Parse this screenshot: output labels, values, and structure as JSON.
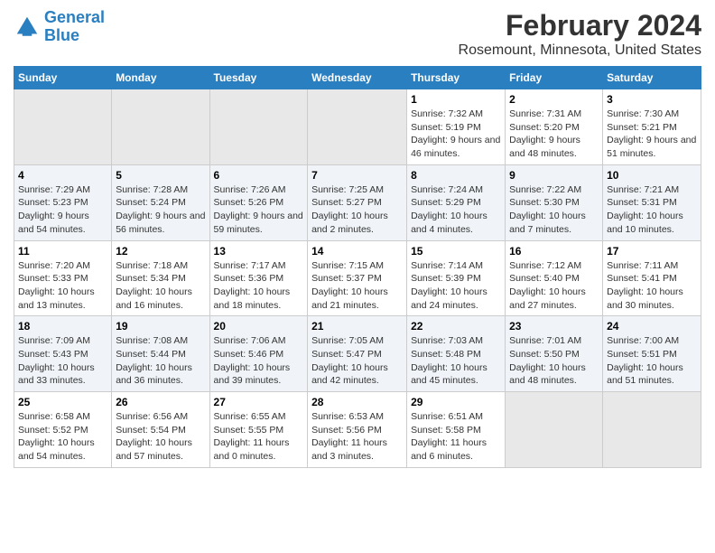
{
  "header": {
    "logo_line1": "General",
    "logo_line2": "Blue",
    "title": "February 2024",
    "subtitle": "Rosemount, Minnesota, United States"
  },
  "columns": [
    "Sunday",
    "Monday",
    "Tuesday",
    "Wednesday",
    "Thursday",
    "Friday",
    "Saturday"
  ],
  "weeks": [
    [
      {
        "day": "",
        "detail": ""
      },
      {
        "day": "",
        "detail": ""
      },
      {
        "day": "",
        "detail": ""
      },
      {
        "day": "",
        "detail": ""
      },
      {
        "day": "1",
        "detail": "Sunrise: 7:32 AM\nSunset: 5:19 PM\nDaylight: 9 hours\nand 46 minutes."
      },
      {
        "day": "2",
        "detail": "Sunrise: 7:31 AM\nSunset: 5:20 PM\nDaylight: 9 hours\nand 48 minutes."
      },
      {
        "day": "3",
        "detail": "Sunrise: 7:30 AM\nSunset: 5:21 PM\nDaylight: 9 hours\nand 51 minutes."
      }
    ],
    [
      {
        "day": "4",
        "detail": "Sunrise: 7:29 AM\nSunset: 5:23 PM\nDaylight: 9 hours\nand 54 minutes."
      },
      {
        "day": "5",
        "detail": "Sunrise: 7:28 AM\nSunset: 5:24 PM\nDaylight: 9 hours\nand 56 minutes."
      },
      {
        "day": "6",
        "detail": "Sunrise: 7:26 AM\nSunset: 5:26 PM\nDaylight: 9 hours\nand 59 minutes."
      },
      {
        "day": "7",
        "detail": "Sunrise: 7:25 AM\nSunset: 5:27 PM\nDaylight: 10 hours\nand 2 minutes."
      },
      {
        "day": "8",
        "detail": "Sunrise: 7:24 AM\nSunset: 5:29 PM\nDaylight: 10 hours\nand 4 minutes."
      },
      {
        "day": "9",
        "detail": "Sunrise: 7:22 AM\nSunset: 5:30 PM\nDaylight: 10 hours\nand 7 minutes."
      },
      {
        "day": "10",
        "detail": "Sunrise: 7:21 AM\nSunset: 5:31 PM\nDaylight: 10 hours\nand 10 minutes."
      }
    ],
    [
      {
        "day": "11",
        "detail": "Sunrise: 7:20 AM\nSunset: 5:33 PM\nDaylight: 10 hours\nand 13 minutes."
      },
      {
        "day": "12",
        "detail": "Sunrise: 7:18 AM\nSunset: 5:34 PM\nDaylight: 10 hours\nand 16 minutes."
      },
      {
        "day": "13",
        "detail": "Sunrise: 7:17 AM\nSunset: 5:36 PM\nDaylight: 10 hours\nand 18 minutes."
      },
      {
        "day": "14",
        "detail": "Sunrise: 7:15 AM\nSunset: 5:37 PM\nDaylight: 10 hours\nand 21 minutes."
      },
      {
        "day": "15",
        "detail": "Sunrise: 7:14 AM\nSunset: 5:39 PM\nDaylight: 10 hours\nand 24 minutes."
      },
      {
        "day": "16",
        "detail": "Sunrise: 7:12 AM\nSunset: 5:40 PM\nDaylight: 10 hours\nand 27 minutes."
      },
      {
        "day": "17",
        "detail": "Sunrise: 7:11 AM\nSunset: 5:41 PM\nDaylight: 10 hours\nand 30 minutes."
      }
    ],
    [
      {
        "day": "18",
        "detail": "Sunrise: 7:09 AM\nSunset: 5:43 PM\nDaylight: 10 hours\nand 33 minutes."
      },
      {
        "day": "19",
        "detail": "Sunrise: 7:08 AM\nSunset: 5:44 PM\nDaylight: 10 hours\nand 36 minutes."
      },
      {
        "day": "20",
        "detail": "Sunrise: 7:06 AM\nSunset: 5:46 PM\nDaylight: 10 hours\nand 39 minutes."
      },
      {
        "day": "21",
        "detail": "Sunrise: 7:05 AM\nSunset: 5:47 PM\nDaylight: 10 hours\nand 42 minutes."
      },
      {
        "day": "22",
        "detail": "Sunrise: 7:03 AM\nSunset: 5:48 PM\nDaylight: 10 hours\nand 45 minutes."
      },
      {
        "day": "23",
        "detail": "Sunrise: 7:01 AM\nSunset: 5:50 PM\nDaylight: 10 hours\nand 48 minutes."
      },
      {
        "day": "24",
        "detail": "Sunrise: 7:00 AM\nSunset: 5:51 PM\nDaylight: 10 hours\nand 51 minutes."
      }
    ],
    [
      {
        "day": "25",
        "detail": "Sunrise: 6:58 AM\nSunset: 5:52 PM\nDaylight: 10 hours\nand 54 minutes."
      },
      {
        "day": "26",
        "detail": "Sunrise: 6:56 AM\nSunset: 5:54 PM\nDaylight: 10 hours\nand 57 minutes."
      },
      {
        "day": "27",
        "detail": "Sunrise: 6:55 AM\nSunset: 5:55 PM\nDaylight: 11 hours\nand 0 minutes."
      },
      {
        "day": "28",
        "detail": "Sunrise: 6:53 AM\nSunset: 5:56 PM\nDaylight: 11 hours\nand 3 minutes."
      },
      {
        "day": "29",
        "detail": "Sunrise: 6:51 AM\nSunset: 5:58 PM\nDaylight: 11 hours\nand 6 minutes."
      },
      {
        "day": "",
        "detail": ""
      },
      {
        "day": "",
        "detail": ""
      }
    ]
  ]
}
